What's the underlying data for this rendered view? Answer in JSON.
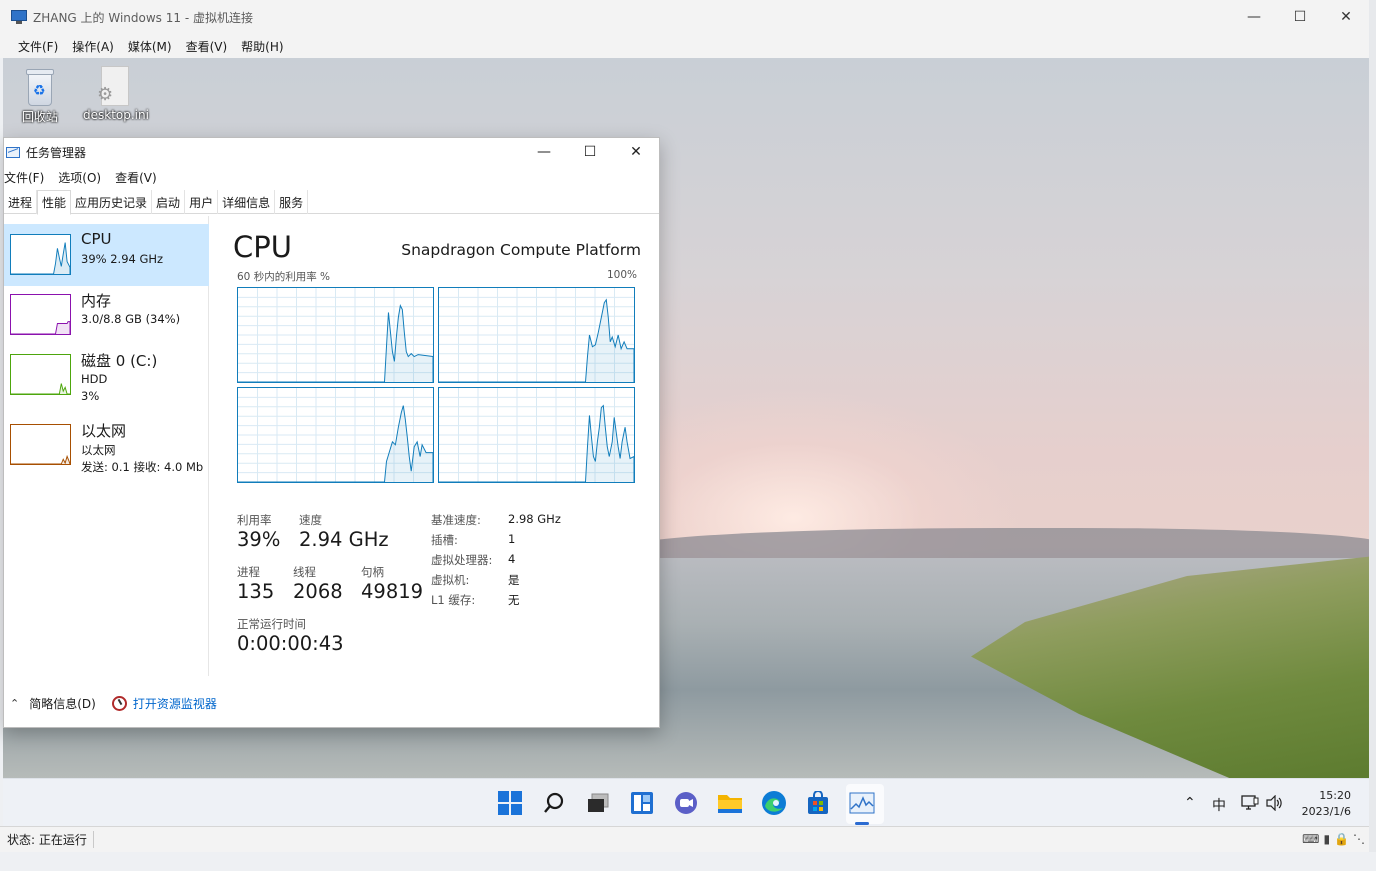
{
  "vm": {
    "title": "ZHANG 上的 Windows 11 - 虚拟机连接",
    "menu": [
      "文件(F)",
      "操作(A)",
      "媒体(M)",
      "查看(V)",
      "帮助(H)"
    ],
    "status": "状态: 正在运行"
  },
  "desktop": {
    "icons": [
      {
        "label": "回收站",
        "icon": "recycle-bin-icon"
      },
      {
        "label": "desktop.ini",
        "icon": "settings-file-icon"
      }
    ]
  },
  "task_manager": {
    "title": "任务管理器",
    "menu": [
      "文件(F)",
      "选项(O)",
      "查看(V)"
    ],
    "tabs": [
      "进程",
      "性能",
      "应用历史记录",
      "启动",
      "用户",
      "详细信息",
      "服务"
    ],
    "active_tab": "性能",
    "sidebar": [
      {
        "name": "CPU",
        "sub1": "39%  2.94 GHz",
        "sub2": "",
        "color": "#117dbb",
        "selected": true
      },
      {
        "name": "内存",
        "sub1": "3.0/8.8 GB (34%)",
        "sub2": "",
        "color": "#8b12ae",
        "selected": false
      },
      {
        "name": "磁盘 0 (C:)",
        "sub1": "HDD",
        "sub2": "3%",
        "color": "#4da60c",
        "selected": false
      },
      {
        "name": "以太网",
        "sub1": "以太网",
        "sub2": "发送: 0.1  接收: 4.0 Mb",
        "color": "#a74f01",
        "selected": false
      }
    ],
    "cpu": {
      "title": "CPU",
      "model": "Snapdragon Compute Platform",
      "graph_label": "60 秒内的利用率 %",
      "graph_max": "100%",
      "stats": {
        "utilization_label": "利用率",
        "utilization": "39%",
        "speed_label": "速度",
        "speed": "2.94 GHz",
        "processes_label": "进程",
        "processes": "135",
        "threads_label": "线程",
        "threads": "2068",
        "handles_label": "句柄",
        "handles": "49819",
        "uptime_label": "正常运行时间",
        "uptime": "0:00:00:43"
      },
      "info": [
        {
          "label": "基准速度:",
          "value": "2.98 GHz"
        },
        {
          "label": "插槽:",
          "value": "1"
        },
        {
          "label": "虚拟处理器:",
          "value": "4"
        },
        {
          "label": "虚拟机:",
          "value": "是"
        },
        {
          "label": "L1 缓存:",
          "value": "无"
        }
      ]
    },
    "footer": {
      "fewer_details": "简略信息(D)",
      "resource_monitor": "打开资源监视器"
    }
  },
  "taskbar": {
    "apps": [
      "start-icon",
      "search-icon",
      "task-view-icon",
      "widgets-icon",
      "chat-icon",
      "file-explorer-icon",
      "edge-icon",
      "store-icon",
      "task-manager-icon"
    ],
    "tray": {
      "ime": "中"
    },
    "time": "15:20",
    "date": "2023/1/6"
  },
  "colors": {
    "accent": "#117dbb",
    "selection": "#cce8ff"
  }
}
